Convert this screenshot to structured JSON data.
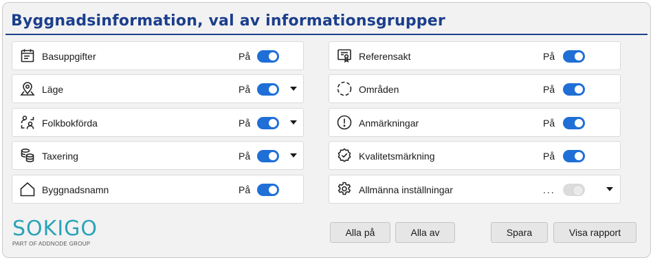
{
  "title": "Byggnadsinformation, val av informationsgrupper",
  "left_items": [
    {
      "label": "Basuppgifter",
      "state": "På",
      "enabled": true,
      "expandable": false,
      "icon": "calendar-list-icon"
    },
    {
      "label": "Läge",
      "state": "På",
      "enabled": true,
      "expandable": true,
      "icon": "map-pin-icon"
    },
    {
      "label": "Folkbokförda",
      "state": "På",
      "enabled": true,
      "expandable": true,
      "icon": "people-icon"
    },
    {
      "label": "Taxering",
      "state": "På",
      "enabled": true,
      "expandable": true,
      "icon": "coin-stack-icon"
    },
    {
      "label": "Byggnadsnamn",
      "state": "På",
      "enabled": true,
      "expandable": false,
      "icon": "house-icon"
    }
  ],
  "right_items": [
    {
      "label": "Referensakt",
      "state": "På",
      "enabled": true,
      "expandable": false,
      "icon": "certificate-icon"
    },
    {
      "label": "Områden",
      "state": "På",
      "enabled": true,
      "expandable": false,
      "icon": "dashed-circle-icon"
    },
    {
      "label": "Anmärkningar",
      "state": "På",
      "enabled": true,
      "expandable": false,
      "icon": "alert-circle-icon"
    },
    {
      "label": "Kvalitetsmärkning",
      "state": "På",
      "enabled": true,
      "expandable": false,
      "icon": "badge-check-icon"
    },
    {
      "label": "Allmänna inställningar",
      "state": "...",
      "enabled": false,
      "expandable": true,
      "icon": "gear-icon"
    }
  ],
  "logo": {
    "name": "SOKIGO",
    "tagline": "PART OF ADDNODE GROUP"
  },
  "buttons": {
    "all_on": "Alla på",
    "all_off": "Alla av",
    "save": "Spara",
    "show_report": "Visa rapport"
  },
  "colors": {
    "title": "#1b3f8c",
    "toggle_on": "#1f6fd6",
    "logo": "#2aa3b8"
  }
}
